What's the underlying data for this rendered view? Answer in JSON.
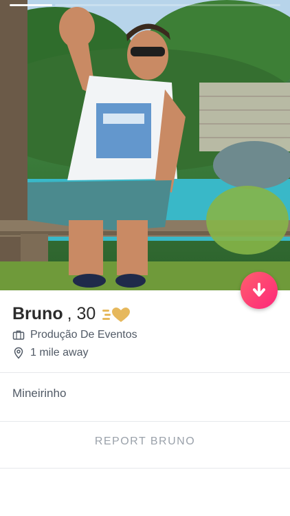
{
  "profile": {
    "name": "Bruno",
    "age_text": ", 30",
    "job": "Produção De Eventos",
    "distance": "1 mile away",
    "bio": "Mineirinho",
    "report_label": "REPORT BRUNO"
  },
  "icons": {
    "gold_badge": "gold-heart-icon",
    "job": "briefcase-icon",
    "distance": "location-pin-icon",
    "collapse": "arrow-down-icon"
  },
  "colors": {
    "accent_gradient_start": "#ff5f6d",
    "accent_gradient_end": "#fd267a",
    "gold": "#e6b85c",
    "text_primary": "#2b2b2b",
    "text_secondary": "#505965",
    "text_muted": "#9aa1aa"
  },
  "photo": {
    "current_index": 1,
    "total": 2
  }
}
